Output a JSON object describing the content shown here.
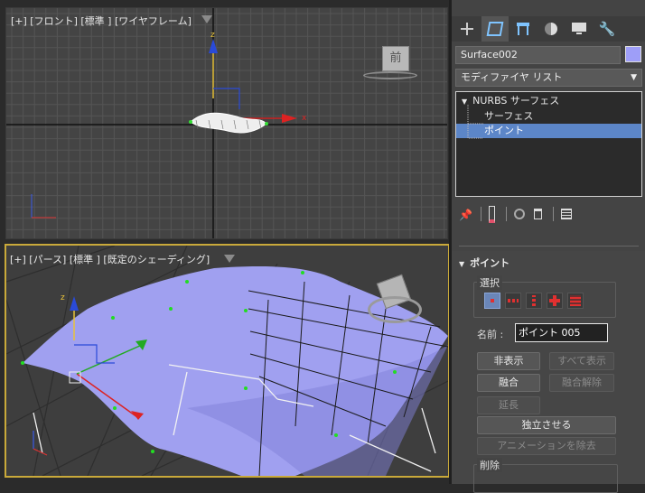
{
  "viewport_top": {
    "label": "[+] [フロント] [標準 ] [ワイヤフレーム]",
    "axis_z": "z",
    "axis_x": "x"
  },
  "viewport_persp": {
    "label": "[+] [パース] [標準 ] [既定のシェーディング]",
    "axis_z": "z"
  },
  "viewcube_top": {
    "face": "前"
  },
  "panel": {
    "object_name": "Surface002",
    "object_color": "#9e9ef8",
    "modifier_list": "モディファイヤ リスト",
    "stack": [
      {
        "label": "NURBS サーフェス",
        "indent": 0,
        "expanded": true
      },
      {
        "label": "サーフェス",
        "indent": 1
      },
      {
        "label": "ポイント",
        "indent": 1,
        "selected": true
      }
    ],
    "rollout_title": "ポイント",
    "selection_group": "選択",
    "name_label": "名前 :",
    "name_value": "ポイント 005",
    "buttons": {
      "hide": "非表示",
      "unhide_all": "すべて表示",
      "fuse": "融合",
      "unfuse": "融合解除",
      "extend": "延長",
      "make_independent": "独立させる",
      "remove_animation": "アニメーションを除去"
    },
    "delete_group": "削除"
  }
}
